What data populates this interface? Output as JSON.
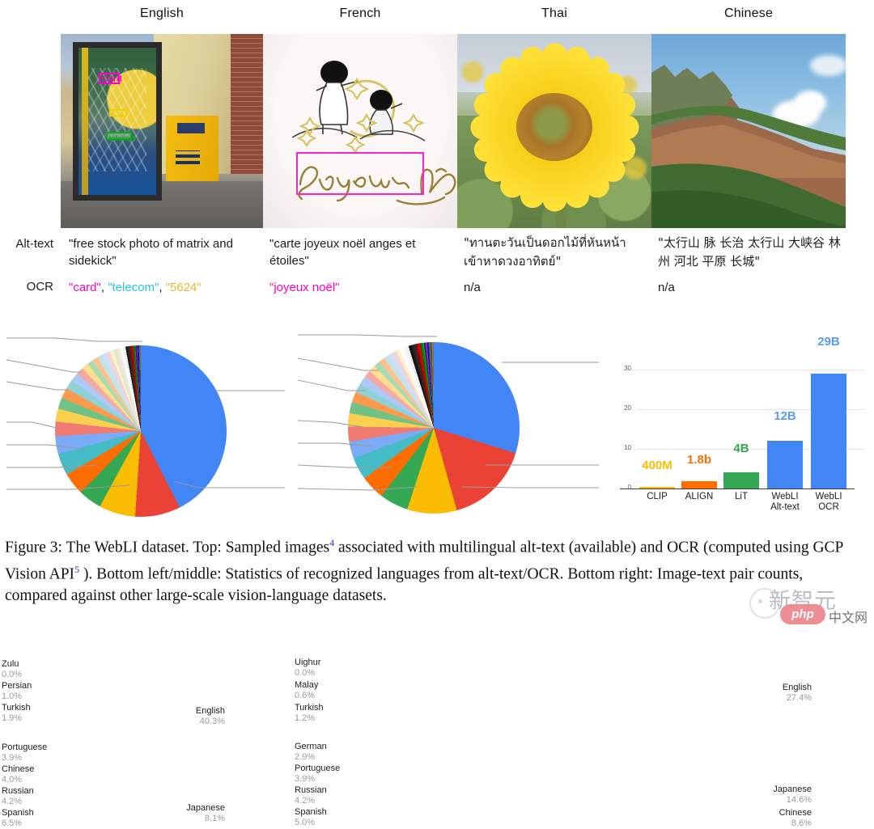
{
  "columns": [
    {
      "language": "English",
      "image_name": "phone-booth-photo",
      "alt_text": "\"free stock photo of matrix and sidekick\"",
      "ocr_plain": null,
      "ocr_tokens": [
        {
          "text": "\"card\"",
          "color": "#ff00cc"
        },
        {
          "text": ", ",
          "color": "#1c1c1c"
        },
        {
          "text": "\"telecom\"",
          "color": "#22c8e0"
        },
        {
          "text": ", ",
          "color": "#1c1c1c"
        },
        {
          "text": "\"5624\"",
          "color": "#f0b52a"
        }
      ],
      "ocr_boxes": [
        {
          "label": "Card",
          "color": "#ff00d0"
        },
        {
          "label": "5624",
          "color": "#f2d100"
        },
        {
          "label": "telecom",
          "color": "#00b30a"
        }
      ]
    },
    {
      "language": "French",
      "image_name": "joyeux-noel-card",
      "alt_text": "\"carte joyeux noël anges et étoiles\"",
      "ocr_tokens": [
        {
          "text": "\"joyeux noël\"",
          "color": "#ff00cc"
        }
      ],
      "ocr_boxes": [
        {
          "label": "",
          "color": "#ff22cc"
        }
      ],
      "image_text": "Joyeux Noël"
    },
    {
      "language": "Thai",
      "image_name": "sunflower-photo",
      "alt_text": "\"ทานตะวันเป็นดอกไม้ที่หันหน้าเข้าหาดวงอาทิตย์\"",
      "ocr_tokens": [
        {
          "text": "n/a",
          "color": "#1c1c1c"
        }
      ]
    },
    {
      "language": "Chinese",
      "image_name": "taihang-mountain-photo",
      "alt_text": "\"太行山 脉 长治 太行山 大峡谷 林州 河北 平原 长城\"",
      "ocr_tokens": [
        {
          "text": "n/a",
          "color": "#1c1c1c"
        }
      ]
    }
  ],
  "row_labels": {
    "alt_text": "Alt-text",
    "ocr": "OCR"
  },
  "chart_data": [
    {
      "type": "pie",
      "name": "alt-text-language-distribution",
      "title": "",
      "labels_shown": [
        {
          "name": "English",
          "value": 40.3,
          "side": "right",
          "color": "#4285f4"
        },
        {
          "name": "Japanese",
          "value": 8.1,
          "side": "right",
          "color": "#ea4335"
        },
        {
          "name": "Spanish",
          "value": 6.5,
          "side": "left",
          "color": "#fbbc04"
        },
        {
          "name": "Russian",
          "value": 4.2,
          "side": "left",
          "color": "#34a853"
        },
        {
          "name": "Chinese",
          "value": 4.0,
          "side": "left",
          "color": "#ff6d01"
        },
        {
          "name": "Portuguese",
          "value": 3.9,
          "side": "left",
          "color": "#46bdc6"
        },
        {
          "name": "Turkish",
          "value": 1.9,
          "side": "left",
          "color": "#7baaf7"
        },
        {
          "name": "Persian",
          "value": 1.0,
          "side": "left",
          "color": "#f07b72"
        },
        {
          "name": "Zulu",
          "value": 0.0,
          "side": "left",
          "color": "#9e9e9e"
        }
      ],
      "slices": [
        40.3,
        8.1,
        6.5,
        4.2,
        4.0,
        3.9,
        3.2,
        2.6,
        2.3,
        2.0,
        1.9,
        1.7,
        1.5,
        1.3,
        1.2,
        1.1,
        1.0,
        0.9,
        0.8,
        0.7,
        0.6,
        0.5,
        0.45,
        0.4,
        0.35,
        0.3,
        0.28,
        0.26,
        0.24,
        0.22,
        0.2,
        0.19,
        0.18,
        0.17,
        0.16,
        0.15,
        0.14,
        0.13,
        0.12,
        0.11,
        0.1,
        0.09,
        0.08,
        0.07,
        0.06,
        0.05
      ],
      "colors": [
        "#4285f4",
        "#ea4335",
        "#fbbc04",
        "#34a853",
        "#ff6d01",
        "#46bdc6",
        "#7baaf7",
        "#f07b72",
        "#fcd04f",
        "#71c287",
        "#ff994d",
        "#8ed2d8",
        "#aec8f7",
        "#f5a9a3",
        "#fddf8d",
        "#a7dbb6",
        "#ffc08c",
        "#bfe5e8",
        "#d2def7",
        "#f8d2cf",
        "#fef0c7",
        "#d2ecd9",
        "#ffe0c4",
        "#e0f2f4",
        "#ffffff",
        "#f4f4f4",
        "#e9e9e9",
        "#111111",
        "#222222",
        "#333333",
        "#8b0000",
        "#b30000",
        "#d40000",
        "#006400",
        "#008000",
        "#00a000",
        "#4b0082",
        "#6a0dad",
        "#8a2be2",
        "#00008b",
        "#0000cd",
        "#2e8b57",
        "#556b2f",
        "#8b4513",
        "#2f4f4f",
        "#708090"
      ]
    },
    {
      "type": "pie",
      "name": "ocr-language-distribution",
      "title": "",
      "labels_shown": [
        {
          "name": "English",
          "value": 27.4,
          "side": "right",
          "color": "#4285f4"
        },
        {
          "name": "Japanese",
          "value": 14.6,
          "side": "right",
          "color": "#ea4335"
        },
        {
          "name": "Chinese",
          "value": 8.6,
          "side": "right",
          "color": "#fbbc04"
        },
        {
          "name": "Spanish",
          "value": 5.0,
          "side": "left",
          "color": "#34a853"
        },
        {
          "name": "Russian",
          "value": 4.2,
          "side": "left",
          "color": "#ff6d01"
        },
        {
          "name": "Portuguese",
          "value": 3.9,
          "side": "left",
          "color": "#46bdc6"
        },
        {
          "name": "German",
          "value": 2.9,
          "side": "left",
          "color": "#7baaf7"
        },
        {
          "name": "Turkish",
          "value": 1.2,
          "side": "left",
          "color": "#f07b72"
        },
        {
          "name": "Malay",
          "value": 0.6,
          "side": "left",
          "color": "#fcd04f"
        },
        {
          "name": "Uighur",
          "value": 0.0,
          "side": "left",
          "color": "#9e9e9e"
        }
      ],
      "slices": [
        27.4,
        14.6,
        8.6,
        5.0,
        4.2,
        3.9,
        2.9,
        2.6,
        2.3,
        2.0,
        1.8,
        1.6,
        1.4,
        1.3,
        1.2,
        1.1,
        1.0,
        0.9,
        0.8,
        0.7,
        0.65,
        0.6,
        0.55,
        0.5,
        0.45,
        0.4,
        0.35,
        0.3,
        0.28,
        0.26,
        0.24,
        0.22,
        0.2,
        0.19,
        0.18,
        0.17,
        0.16,
        0.15,
        0.14,
        0.13,
        0.12,
        0.11,
        0.1,
        0.09,
        0.08,
        0.07
      ],
      "colors": [
        "#4285f4",
        "#ea4335",
        "#fbbc04",
        "#34a853",
        "#ff6d01",
        "#46bdc6",
        "#7baaf7",
        "#f07b72",
        "#fcd04f",
        "#71c287",
        "#ff994d",
        "#8ed2d8",
        "#aec8f7",
        "#f5a9a3",
        "#fddf8d",
        "#a7dbb6",
        "#ffc08c",
        "#bfe5e8",
        "#d2def7",
        "#f8d2cf",
        "#fef0c7",
        "#ffffff",
        "#f7f7f7",
        "#ececec",
        "#111111",
        "#1f1f1f",
        "#2d2d2d",
        "#8b0000",
        "#c20000",
        "#e60000",
        "#006400",
        "#009000",
        "#00b000",
        "#4b0082",
        "#7a1fa2",
        "#9932cc",
        "#00008b",
        "#1a1ae0",
        "#2e8b57",
        "#556b2f",
        "#8b4513",
        "#2f4f4f",
        "#708090",
        "#b8860b",
        "#20b2aa",
        "#dc143c"
      ]
    },
    {
      "type": "bar",
      "name": "image-text-pair-counts",
      "title": "",
      "xlabel": "",
      "ylabel": "",
      "ylim": [
        0,
        33
      ],
      "yticks": [
        0,
        10,
        20,
        30
      ],
      "grid": true,
      "categories": [
        "CLIP",
        "ALIGN",
        "LiT",
        "WebLI\nAlt-text",
        "WebLI\nOCR"
      ],
      "category_lines": [
        [
          "CLIP"
        ],
        [
          "ALIGN"
        ],
        [
          "LiT"
        ],
        [
          "WebLI",
          "Alt-text"
        ],
        [
          "WebLI",
          "OCR"
        ]
      ],
      "values": [
        0.4,
        1.8,
        4.0,
        12.0,
        29.0
      ],
      "value_labels": [
        "400M",
        "1.8b",
        "4B",
        "12B",
        "29B"
      ],
      "colors": [
        "#fbbc04",
        "#ff6d01",
        "#34a853",
        "#4285f4",
        "#4285f4"
      ]
    }
  ],
  "caption": {
    "part1": "Figure 3: The WebLI dataset. Top: Sampled images",
    "sup1": "4",
    "part2": " associated with multilingual alt-text (available) and OCR (computed using GCP Vision API",
    "sup2": "5",
    "part3": " ). Bottom left/middle: Statistics of recognized languages from alt-text/OCR. Bottom right: Image-text pair counts, compared against other large-scale vision-language datasets."
  },
  "watermark": {
    "brand_cn": "新智元",
    "php_badge": "php",
    "site_cn": "中文网"
  }
}
